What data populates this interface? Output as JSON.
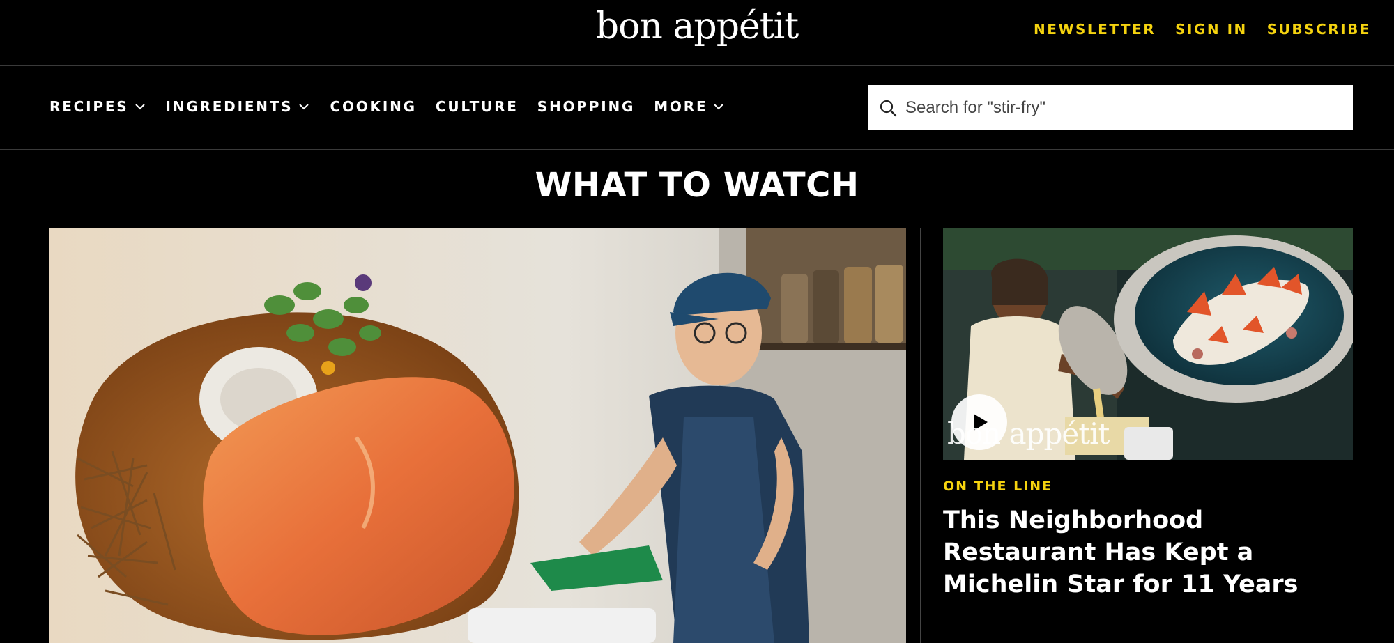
{
  "header": {
    "logo": "bon appétit",
    "links": [
      "NEWSLETTER",
      "SIGN IN",
      "SUBSCRIBE"
    ]
  },
  "nav": {
    "items": [
      {
        "label": "RECIPES",
        "dropdown": true
      },
      {
        "label": "INGREDIENTS",
        "dropdown": true
      },
      {
        "label": "COOKING",
        "dropdown": false
      },
      {
        "label": "CULTURE",
        "dropdown": false
      },
      {
        "label": "SHOPPING",
        "dropdown": false
      },
      {
        "label": "MORE",
        "dropdown": true
      }
    ],
    "search_placeholder": "Search for \"stir-fry\""
  },
  "section": {
    "title": "WHAT TO WATCH"
  },
  "side_card": {
    "watermark": "bon appétit",
    "kicker": "ON THE LINE",
    "headline": "This Neighborhood Restaurant Has Kept a Michelin Star for 11 Years",
    "play_icon": "play-icon"
  },
  "colors": {
    "background": "#000000",
    "accent": "#f5d30f",
    "text": "#ffffff"
  }
}
